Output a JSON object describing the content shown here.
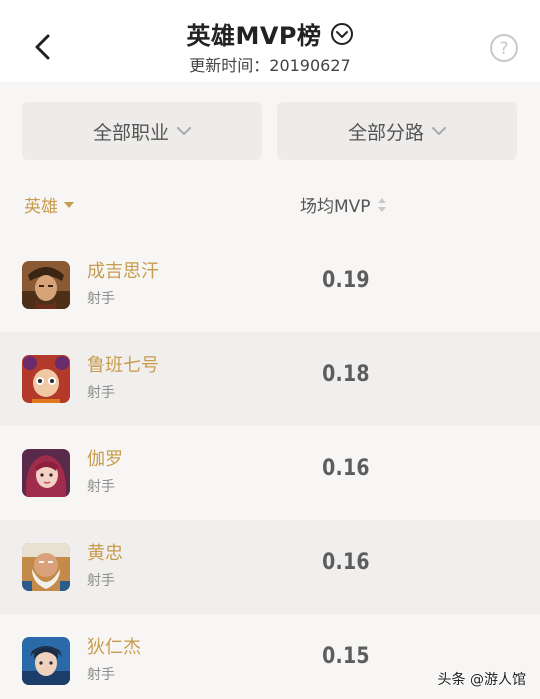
{
  "header": {
    "title": "英雄MVP榜",
    "update_label": "更新时间：20190627"
  },
  "filters": {
    "profession": "全部职业",
    "lane": "全部分路"
  },
  "columns": {
    "hero": "英雄",
    "mvp": "场均MVP"
  },
  "heroes": [
    {
      "name": "成吉思汗",
      "role": "射手",
      "mvp": "0.19",
      "avatar_icon": "genghis-khan-avatar"
    },
    {
      "name": "鲁班七号",
      "role": "射手",
      "mvp": "0.18",
      "avatar_icon": "luban-avatar"
    },
    {
      "name": "伽罗",
      "role": "射手",
      "mvp": "0.16",
      "avatar_icon": "jialuo-avatar"
    },
    {
      "name": "黄忠",
      "role": "射手",
      "mvp": "0.16",
      "avatar_icon": "huangzhong-avatar"
    },
    {
      "name": "狄仁杰",
      "role": "射手",
      "mvp": "0.15",
      "avatar_icon": "direnjie-avatar"
    }
  ],
  "watermark": "头条 @游人馆",
  "colors": {
    "accent_gold": "#c89c4e",
    "background": "#f7f6f4",
    "header_bg": "#ffffff"
  }
}
